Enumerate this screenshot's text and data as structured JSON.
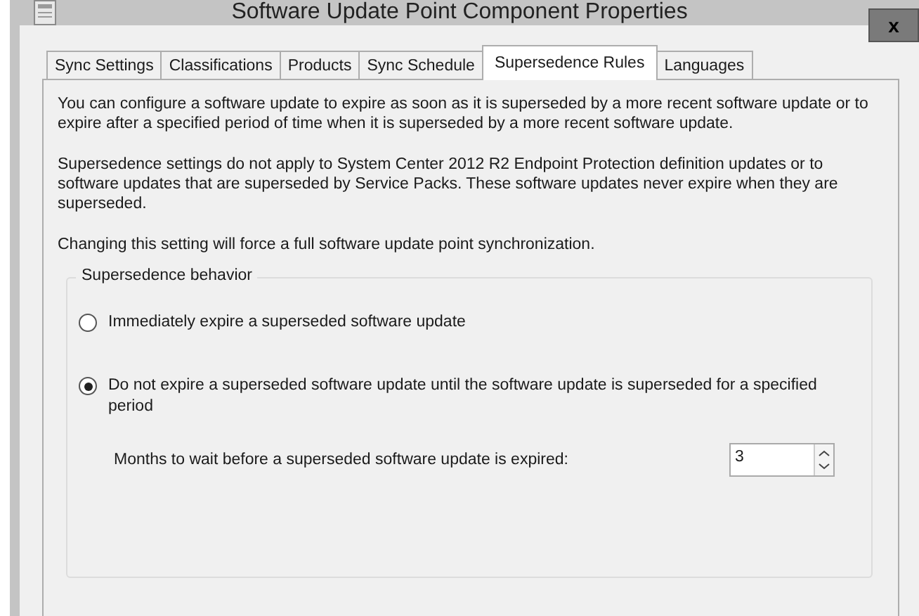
{
  "window": {
    "title": "Software Update Point Component Properties",
    "close": "x"
  },
  "tabs": [
    {
      "label": "Sync Settings",
      "selected": false
    },
    {
      "label": "Classifications",
      "selected": false
    },
    {
      "label": "Products",
      "selected": false
    },
    {
      "label": "Sync Schedule",
      "selected": false
    },
    {
      "label": "Supersedence Rules",
      "selected": true
    },
    {
      "label": "Languages",
      "selected": false
    }
  ],
  "paragraphs": [
    "You can configure a software update to expire as soon as it is superseded by a more recent software update or to expire after a specified period of time when it is superseded by a more recent software update.",
    "Supersedence settings do not apply to System Center 2012 R2 Endpoint Protection definition updates or to software updates that are superseded by Service Packs. These software updates never expire when they are superseded.",
    "Changing this setting will force a full software update point synchronization."
  ],
  "group": {
    "title": "Supersedence behavior",
    "options": [
      {
        "label": "Immediately expire a superseded software update",
        "selected": false
      },
      {
        "label": "Do not expire a superseded software update until the software update is superseded for a specified period",
        "selected": true
      }
    ],
    "months": {
      "label": "Months to wait before a superseded software update is expired:",
      "value": "3"
    }
  }
}
